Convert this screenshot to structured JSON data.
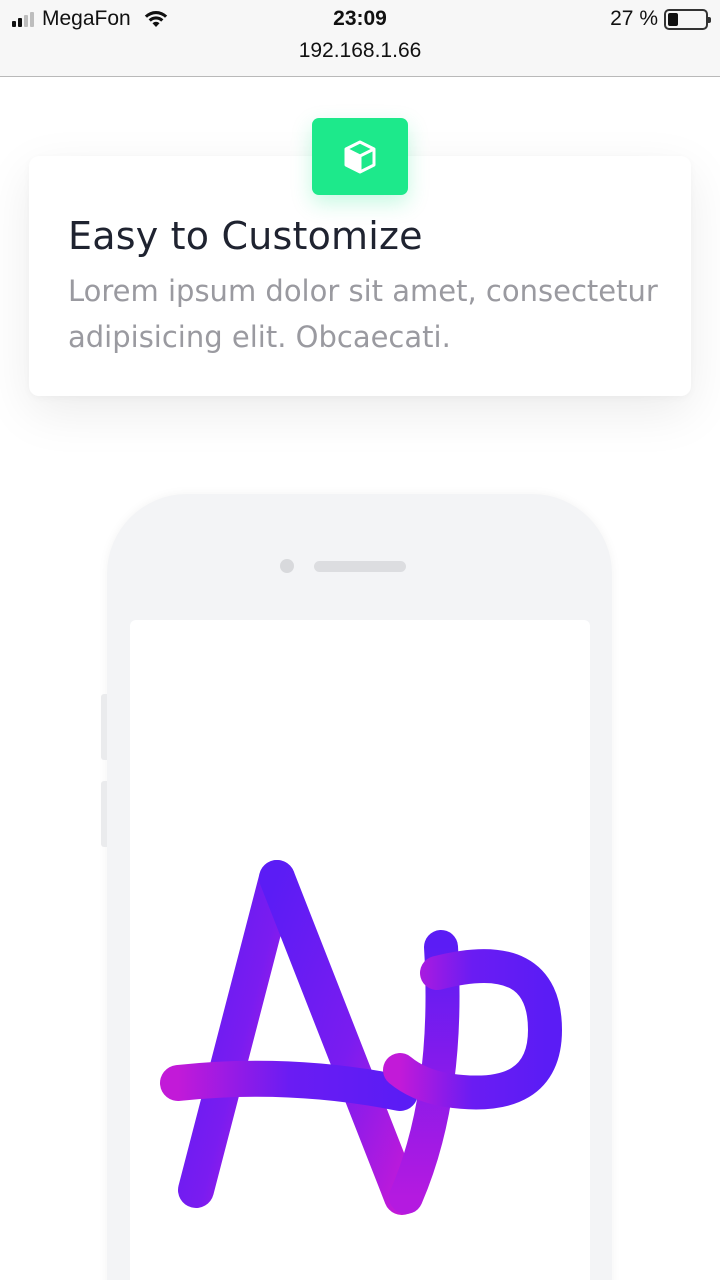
{
  "status_bar": {
    "carrier": "MegaFon",
    "time": "23:09",
    "url": "192.168.1.66",
    "battery_percent": "27 %",
    "battery_level": 0.27
  },
  "feature": {
    "icon": "cube-icon",
    "title": "Easy to Customize",
    "description": "Lorem ipsum dolor sit amet, consectetur adipisicing elit. Obcaecati."
  },
  "phone_mockup": {
    "logo_icon": "ap-logo"
  },
  "colors": {
    "accent_green": "#1de98b",
    "logo_purple": "#5b1cf5",
    "logo_magenta": "#c21ad8",
    "title_text": "#1f2330",
    "body_text": "#9a9aa0"
  }
}
